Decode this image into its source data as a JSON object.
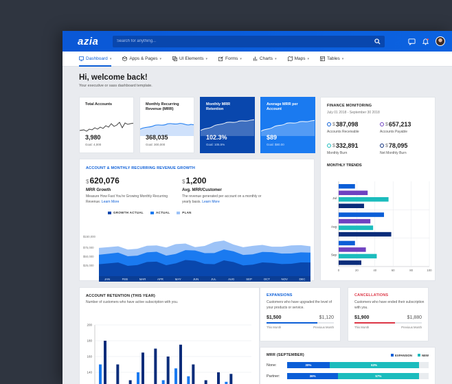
{
  "app": {
    "logo": "azia"
  },
  "search": {
    "placeholder": "Search for anything..."
  },
  "nav": [
    {
      "label": "Dashboard",
      "icon": "monitor-icon"
    },
    {
      "label": "Apps & Pages",
      "icon": "package-icon"
    },
    {
      "label": "UI Elements",
      "icon": "layers-icon"
    },
    {
      "label": "Forms",
      "icon": "edit-icon"
    },
    {
      "label": "Charts",
      "icon": "bar-chart-icon"
    },
    {
      "label": "Maps",
      "icon": "map-icon"
    },
    {
      "label": "Tables",
      "icon": "table-icon"
    }
  ],
  "welcome": {
    "title": "Hi, welcome back!",
    "subtitle": "Your executive or sass dashboard template."
  },
  "kpis": [
    {
      "title": "Total Accounts",
      "value": "3,980",
      "goal": "Goal: 4,000"
    },
    {
      "title": "Monthly Recurring Revenue (MRR)",
      "value": "368,035",
      "goal": "Goal: 300,000"
    },
    {
      "title": "Monthly MRR Retention",
      "value": "102.3%",
      "goal": "Goal: 105.5%"
    },
    {
      "title": "Average MRR per Account",
      "value": "$89",
      "goal": "Goal: $80.00"
    }
  ],
  "growth": {
    "title": "ACCOUNT & MONTHLY RECURRING REVENUE GROWTH",
    "stat1": {
      "currency": "$",
      "value": "620,076",
      "label": "MRR Growth",
      "desc": "Measure How Fast You're Growing Monthly Recurring Revenue.",
      "link": "Learn More"
    },
    "stat2": {
      "currency": "$",
      "value": "1,200",
      "label": "Avg. MRR/Customer",
      "desc": "The revenue generated per account on a monthly or yearly basis.",
      "link": "Learn More"
    },
    "legend": [
      "GROWTH ACTUAL",
      "ACTUAL",
      "PLAN"
    ],
    "colors": {
      "growth": "#0947ad",
      "actual": "#1a7af0",
      "plan": "#9dc3f7"
    }
  },
  "finance": {
    "title": "FINANCE MONITORING",
    "subtitle": "July 01 2018 - September 30 2018",
    "items": [
      {
        "value": "387,098",
        "label": "Accounts Receivable",
        "color": "#0b5ed7"
      },
      {
        "value": "657,213",
        "label": "Accounts Payable",
        "color": "#6f42c1"
      },
      {
        "value": "332,891",
        "label": "Monthly Burn",
        "color": "#1bbcbd"
      },
      {
        "value": "78,095",
        "label": "Net Monthly Burn",
        "color": "#0a2c7a"
      }
    ],
    "currency": "$",
    "trends_title": "MONTHLY TRENDS"
  },
  "retention": {
    "title": "ACCOUNT RETENTION (THIS YEAR)",
    "subtitle": "Number of customers who have active subscription with you."
  },
  "expansions": {
    "title": "EXPANSIONS",
    "desc": "Customers who have upgraded the level of your products or service.",
    "current": "$1,500",
    "previous": "$1,120",
    "current_label": "This Month",
    "previous_label": "Previous Month",
    "progress": 0.75,
    "color": "#0b5ed7"
  },
  "cancellations": {
    "title": "CANCELLATIONS",
    "desc": "Customers who have ended their subscription with you.",
    "current": "$1,900",
    "previous": "$1,880",
    "current_label": "This Month",
    "previous_label": "Previous Month",
    "progress": 0.6,
    "color": "#dc3545"
  },
  "mrr": {
    "title": "MRR (SEPTEMBER)",
    "legend": [
      "EXPANSION",
      "NEW"
    ],
    "rows": [
      {
        "label": "None:",
        "expansion": 30,
        "new": 63,
        "expansion_label": "30%",
        "new_label": "63%"
      },
      {
        "label": "Partner:",
        "expansion": 36,
        "new": 57,
        "expansion_label": "36%",
        "new_label": "57%"
      }
    ]
  },
  "chart_data": [
    {
      "type": "area",
      "title": "",
      "categories": [
        "JAN",
        "FEB",
        "MAR",
        "APR",
        "MAY",
        "JUN",
        "JUL",
        "AUG",
        "SEP",
        "OCT",
        "NOV",
        "DEC"
      ],
      "y_ticks": [
        "$150,000",
        "$75,000",
        "$50,000",
        "$25,000"
      ],
      "series": [
        {
          "name": "PLAN",
          "values": [
            66000,
            70000,
            64000,
            72000,
            75000,
            68000,
            80000,
            74000,
            71000,
            69000,
            72000,
            70000
          ]
        },
        {
          "name": "ACTUAL",
          "values": [
            50000,
            55000,
            48000,
            57000,
            52000,
            60000,
            54000,
            58000,
            51000,
            56000,
            53000,
            55000
          ]
        },
        {
          "name": "GROWTH ACTUAL",
          "values": [
            28000,
            32000,
            26000,
            34000,
            30000,
            36000,
            28000,
            33000,
            27000,
            31000,
            29000,
            32000
          ]
        }
      ]
    },
    {
      "type": "bar",
      "title": "",
      "orientation": "horizontal",
      "categories": [
        "Jul",
        "Aug",
        "Sep"
      ],
      "xlim": [
        0,
        100
      ],
      "series": [
        {
          "name": "",
          "color": "#0b5ed7",
          "values": [
            18,
            50,
            18
          ]
        },
        {
          "name": "",
          "color": "#6f42c1",
          "values": [
            32,
            35,
            30
          ]
        },
        {
          "name": "",
          "color": "#1bbcbd",
          "values": [
            55,
            38,
            42
          ]
        },
        {
          "name": "",
          "color": "#0a2c7a",
          "values": [
            28,
            58,
            25
          ]
        }
      ]
    },
    {
      "type": "bar",
      "title": "",
      "y_ticks": [
        200,
        180,
        160,
        140,
        120,
        100,
        80
      ],
      "ylim": [
        80,
        200
      ],
      "series": [
        {
          "name": "",
          "color": "#1a7af0",
          "values": [
            150,
            120,
            110,
            140,
            125,
            130,
            145,
            135,
            115,
            120,
            128,
            118
          ]
        },
        {
          "name": "",
          "color": "#0a2c7a",
          "values": [
            180,
            150,
            130,
            165,
            170,
            160,
            175,
            150,
            130,
            140,
            138,
            125
          ]
        }
      ]
    }
  ]
}
